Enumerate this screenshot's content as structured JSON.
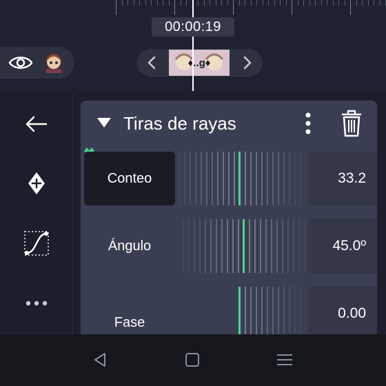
{
  "timeline": {
    "timecode": "00:00:19",
    "strip_label": "♦..g♦"
  },
  "icons": {
    "eye": "eye-icon",
    "layer_thumbnail": "character-thumbnail",
    "prev_keyframe": "chevron-left-icon",
    "next_keyframe": "chevron-right-icon",
    "back": "arrow-left-icon",
    "add_keyframe": "diamond-plus-icon",
    "easing": "easing-curve-icon",
    "more": "more-horizontal-icon",
    "collapse": "triangle-down-icon",
    "menu": "more-vertical-icon",
    "delete": "trash-icon",
    "keyframe_marker": "keyframe-marker-icon"
  },
  "panel": {
    "title": "Tiras de rayas",
    "params": [
      {
        "label": "Conteo",
        "value": "33.2",
        "active": true
      },
      {
        "label": "Ángulo",
        "value": "45.0º",
        "active": false
      },
      {
        "label": "Fase",
        "value": "0.00",
        "active": false
      }
    ]
  },
  "system_nav": [
    "back-nav-icon",
    "home-nav-icon",
    "recents-nav-icon"
  ],
  "colors": {
    "accent": "#4fd38f",
    "panel_bg": "#3a3e52",
    "background": "#1c1f2b"
  }
}
